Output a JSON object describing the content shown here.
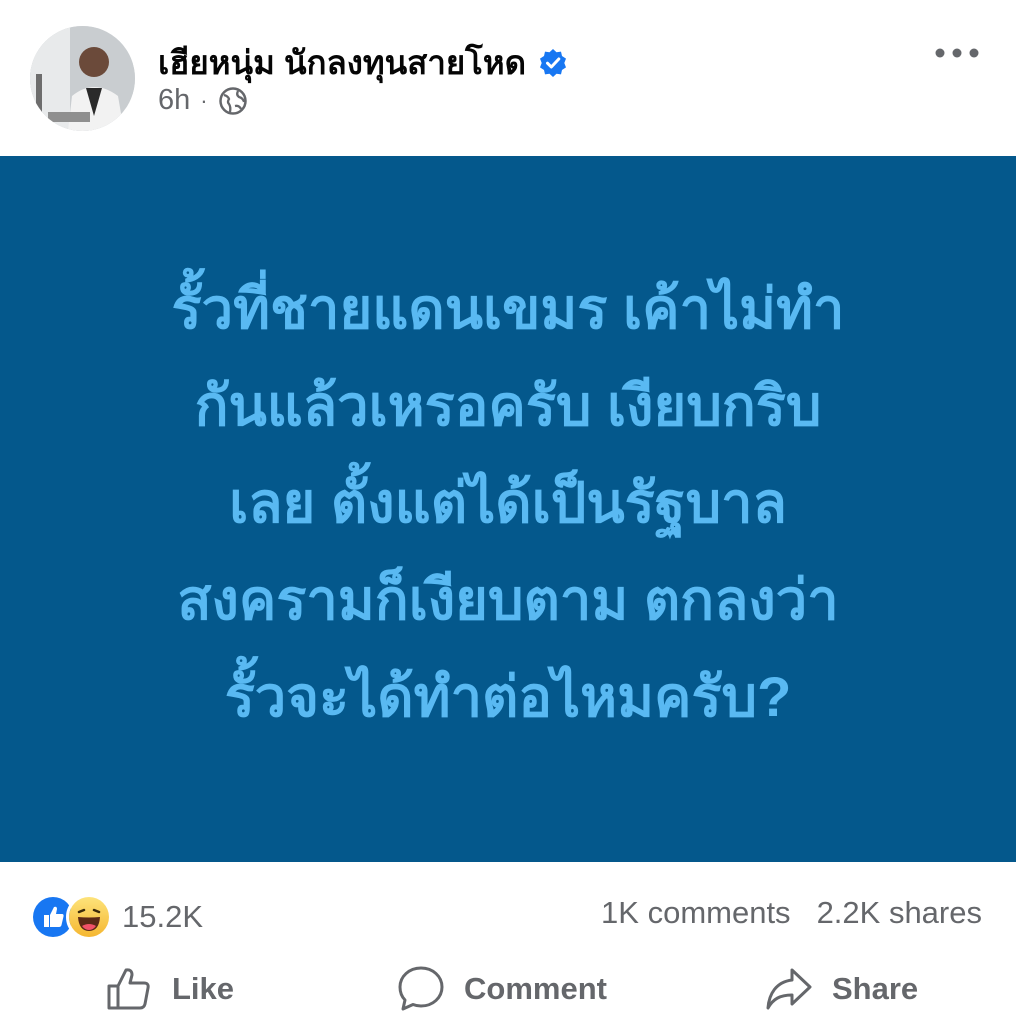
{
  "post": {
    "author": "เฮียหนุ่ม นักลงทุนสายโหด",
    "time": "6h",
    "separator": "·",
    "verified": true,
    "background_color": "#04588c",
    "text_color": "#59b9f2",
    "text_lines": [
      "รั้วที่ชายแดนเขมร เค้าไม่ทำ",
      "กันแล้วเหรอครับ เงียบกริบ",
      "เลย ตั้งแต่ได้เป็นรัฐบาล",
      "สงครามก็เงียบตาม ตกลงว่า",
      "รั้วจะได้ทำต่อไหมครับ?"
    ]
  },
  "stats": {
    "reactions_count": "15.2K",
    "comments": "1K comments",
    "shares": "2.2K shares"
  },
  "actions": {
    "like_label": "Like",
    "comment_label": "Comment",
    "share_label": "Share"
  },
  "icons": {
    "verified": "verified-badge-icon",
    "audience": "globe-icon",
    "more": "more-options-icon",
    "like_reaction": "like-reaction-icon",
    "haha_reaction": "haha-reaction-icon",
    "like_action": "thumbs-up-icon",
    "comment_action": "speech-bubble-icon",
    "share_action": "share-arrow-icon"
  },
  "colors": {
    "accent_blue": "#1877f2",
    "secondary_text": "#65676b"
  }
}
